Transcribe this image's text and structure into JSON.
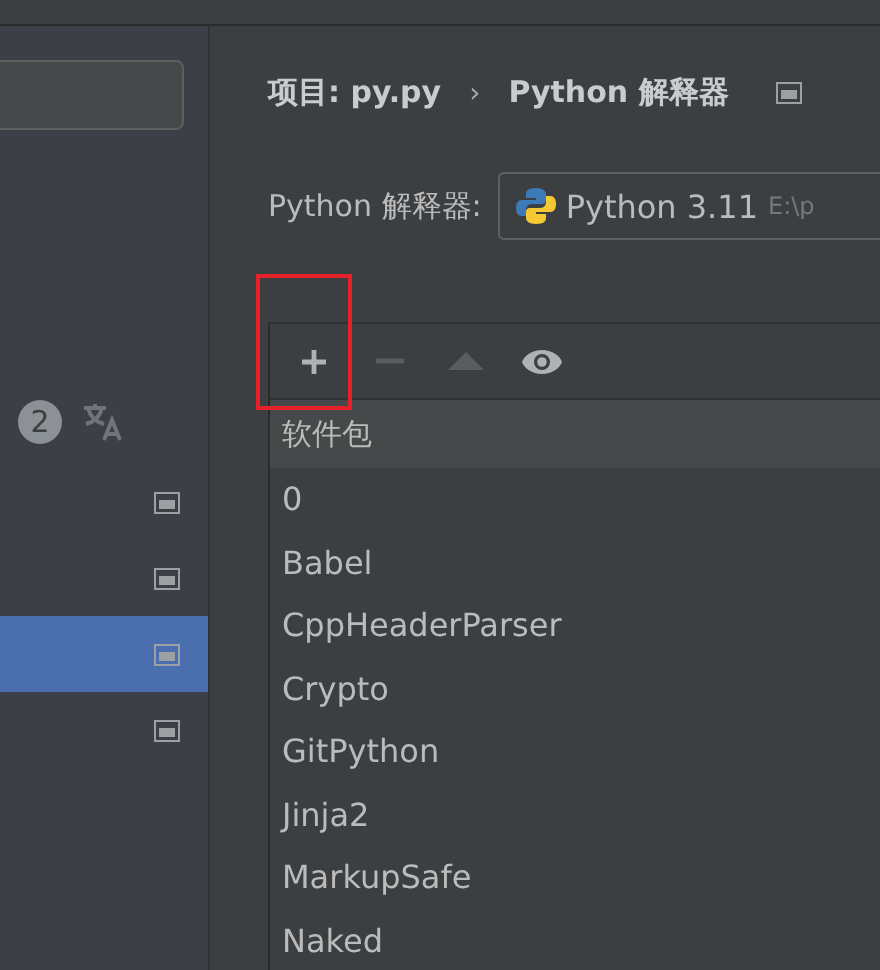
{
  "sidebar": {
    "badge": "2",
    "items": [
      {
        "selected": false
      },
      {
        "selected": false
      },
      {
        "selected": true
      },
      {
        "selected": false
      }
    ]
  },
  "breadcrumb": {
    "project": "项目: py.py",
    "separator": "›",
    "page": "Python 解释器"
  },
  "interpreter": {
    "label": "Python 解释器:",
    "name": "Python 3.11",
    "path": "E:\\p"
  },
  "toolbar": [
    {
      "kind": "add",
      "disabled": false
    },
    {
      "kind": "remove",
      "disabled": true
    },
    {
      "kind": "upgrade",
      "disabled": true
    },
    {
      "kind": "show",
      "disabled": false
    }
  ],
  "table": {
    "columns": [
      "软件包"
    ],
    "rows": [
      "0",
      "Babel",
      "CppHeaderParser",
      "Crypto",
      "GitPython",
      "Jinja2",
      "MarkupSafe",
      "Naked"
    ]
  }
}
